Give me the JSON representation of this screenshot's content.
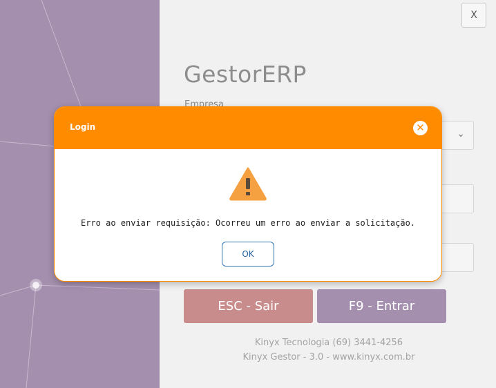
{
  "window": {
    "close_label": "X"
  },
  "app": {
    "title": "GestorERP"
  },
  "form": {
    "empresa_label": "Empresa"
  },
  "buttons": {
    "sair_label": "ESC - Sair",
    "entrar_label": "F9 - Entrar"
  },
  "footer": {
    "company_line": "Kinyx Tecnologia (69) 3441-4256",
    "version_line": "Kinyx Gestor - 3.0 - www.kinyx.com.br"
  },
  "dialog": {
    "title": "Login",
    "message": "Erro ao enviar requisição: Ocorreu um erro ao enviar a solicitação.",
    "ok_label": "OK",
    "icon": "warning-icon"
  },
  "colors": {
    "dialog_header": "#ff8c00",
    "sidebar": "#a48fae",
    "sair_button": "#c98c8c",
    "entrar_button": "#a48fae"
  }
}
